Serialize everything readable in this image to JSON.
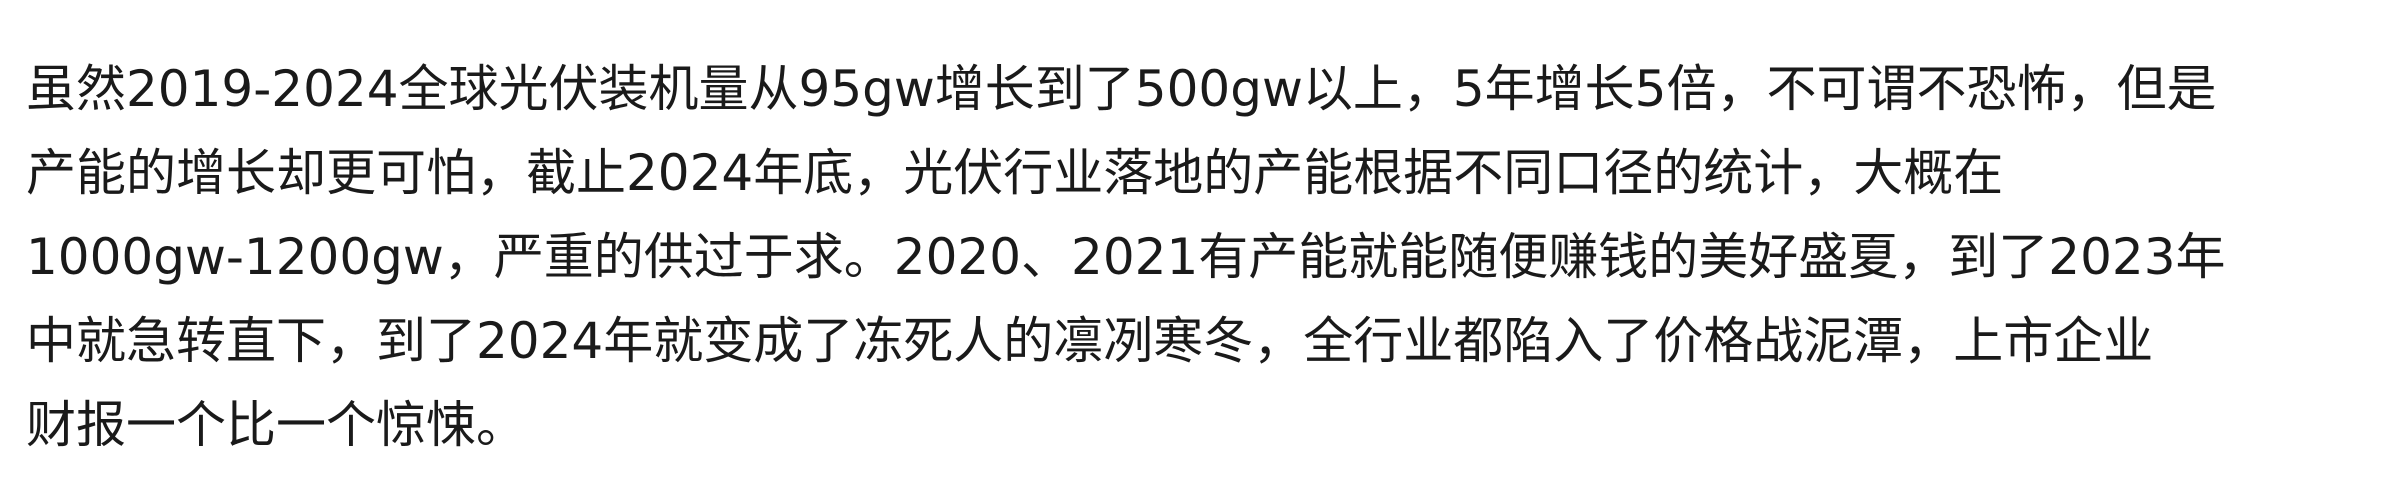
{
  "article": {
    "lines": [
      "虽然2019-2024全球光伏装机量从95gw增长到了500gw以上，5年增长5倍，不可谓不恐怖，但是",
      "产能的增长却更可怕，截止2024年底，光伏行业落地的产能根据不同口径的统计，大概在",
      "1000gw-1200gw，严重的供过于求。2020、2021有产能就能随便赚钱的美好盛夏，到了2023年",
      "中就急转直下，到了2024年就变成了冻死人的凛冽寒冬，全行业都陷入了价格战泥潭，上市企业",
      "财报一个比一个惊悚。"
    ]
  }
}
